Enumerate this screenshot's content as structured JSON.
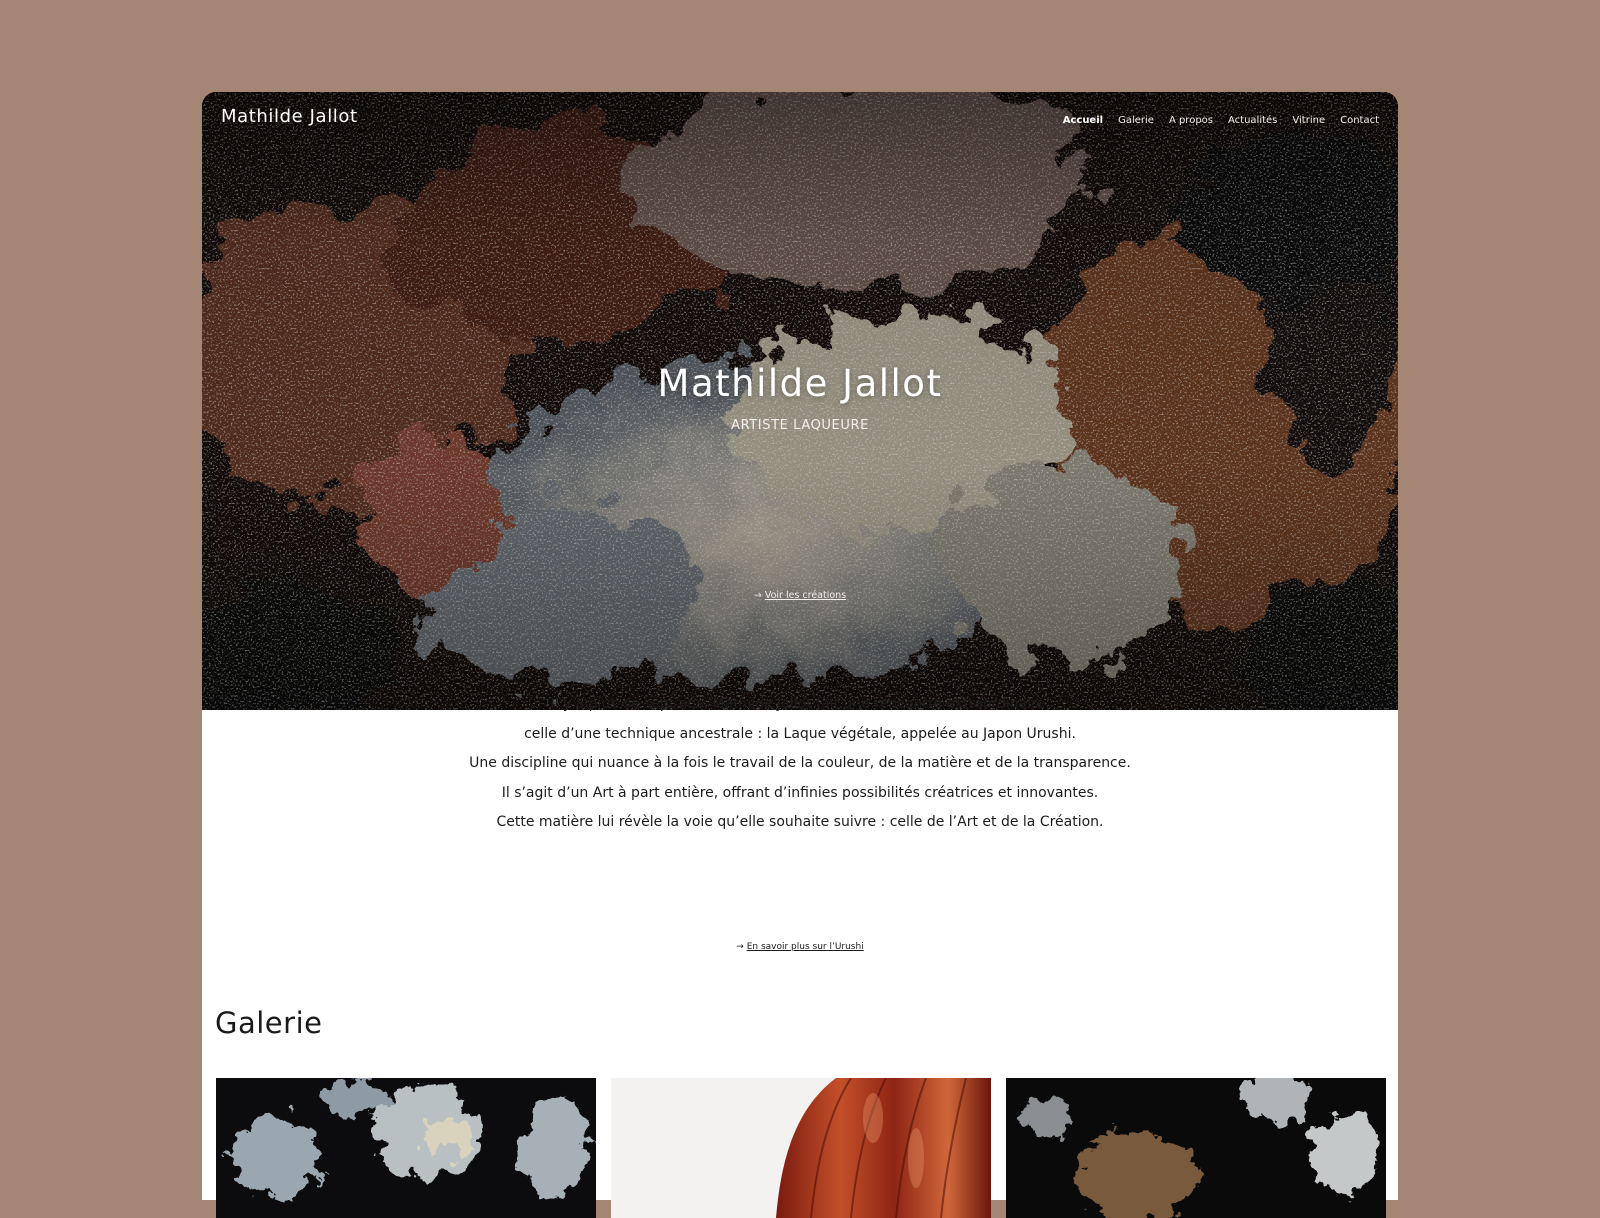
{
  "site": {
    "title": "Mathilde Jallot"
  },
  "nav": {
    "items": [
      {
        "label": "Accueil",
        "active": true
      },
      {
        "label": "Galerie",
        "active": false
      },
      {
        "label": "A propos",
        "active": false
      },
      {
        "label": "Actualités",
        "active": false
      },
      {
        "label": "Vitrine",
        "active": false
      },
      {
        "label": "Contact",
        "active": false
      }
    ]
  },
  "hero": {
    "heading": "Mathilde Jallot",
    "subtitle": "ARTISTE LAQUEURE",
    "link_arrow": "→",
    "link_label": "Voir les créations"
  },
  "intro": {
    "lines": [
      "Il y a plus de sept ans, Mathilde Jallot fait une rencontre extraordinaire,",
      "celle d’une technique ancestrale : la Laque végétale, appelée au Japon Urushi.",
      "Une discipline qui nuance à la fois le travail de la couleur, de la matière et de la transparence.",
      "Il s’agit d’un Art à part entière, offrant d’infinies possibilités créatrices et innovantes.",
      "Cette matière lui révèle la voie qu’elle souhaite suivre : celle de l’Art et de la Création."
    ],
    "link_arrow": "→",
    "link_label": "En savoir plus sur l’Urushi"
  },
  "gallery": {
    "heading": "Galerie"
  },
  "colors": {
    "background": "#a58674",
    "card": "#ffffff",
    "text": "#1c1c1c"
  }
}
